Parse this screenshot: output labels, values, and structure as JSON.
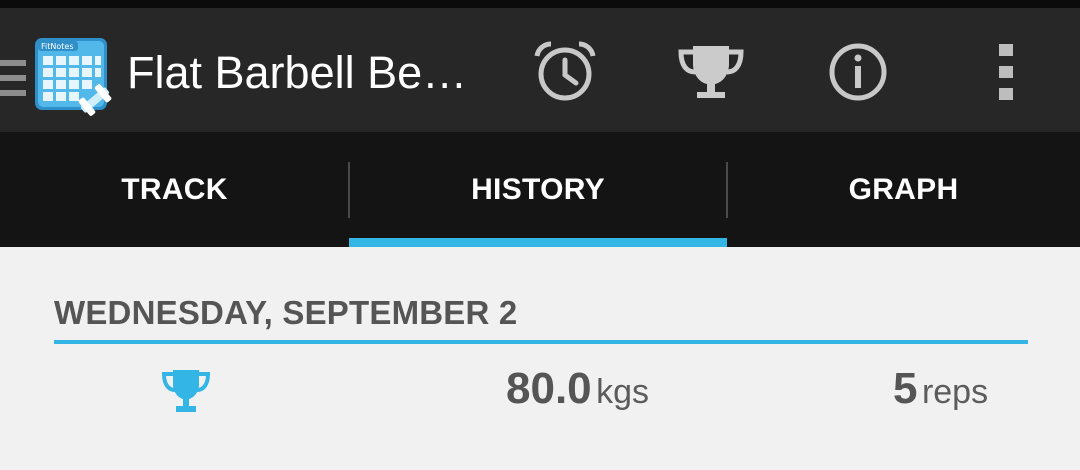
{
  "app": {
    "logo_text": "FitNotes",
    "title": "Flat Barbell Be…"
  },
  "actions": [
    {
      "name": "rest-timer",
      "icon": "alarm-clock-icon"
    },
    {
      "name": "records",
      "icon": "trophy-icon"
    },
    {
      "name": "exercise-info",
      "icon": "info-icon"
    },
    {
      "name": "overflow-menu",
      "icon": "more-vert-icon"
    }
  ],
  "tabs": [
    {
      "label": "TRACK",
      "selected": false
    },
    {
      "label": "HISTORY",
      "selected": true
    },
    {
      "label": "GRAPH",
      "selected": false
    }
  ],
  "history": {
    "date": "WEDNESDAY, SEPTEMBER 2",
    "sets": [
      {
        "personal_record": true,
        "weight": "80.0",
        "weight_unit": "kgs",
        "reps": "5",
        "reps_unit": "reps"
      }
    ]
  },
  "colors": {
    "accent": "#33b5e5",
    "action_bar": "#272727",
    "tab_bar": "#141414",
    "background": "#f1f1f1"
  }
}
